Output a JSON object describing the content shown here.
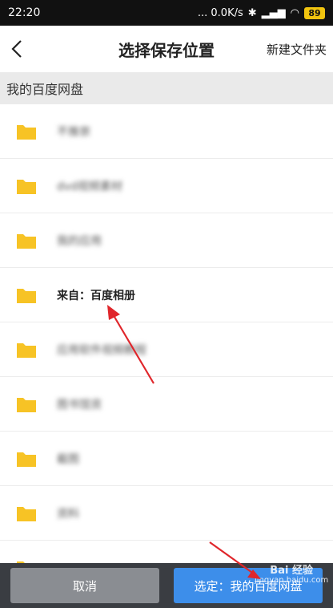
{
  "status_bar": {
    "time": "22:20",
    "network_speed": "... 0.0K/s",
    "battery": "89"
  },
  "header": {
    "title": "选择保存位置",
    "new_folder": "新建文件夹"
  },
  "breadcrumb": "我的百度网盘",
  "folders": [
    {
      "label": "不推崇"
    },
    {
      "label": "dvd视频素材"
    },
    {
      "label": "我的应用"
    },
    {
      "label": "来自：百度相册"
    },
    {
      "label": "应用软件视频教程"
    },
    {
      "label": "图书馆资"
    },
    {
      "label": "截图"
    },
    {
      "label": "资料"
    },
    {
      "label": ""
    }
  ],
  "footer": {
    "cancel": "取消",
    "confirm": "选定：我的百度网盘"
  },
  "watermark": {
    "main": "Bai 经验",
    "sub": "jingyan.baidu.com"
  },
  "colors": {
    "folder": "#f7c325",
    "confirm": "#3d8eea",
    "annotation_arrow": "#e0262b"
  }
}
